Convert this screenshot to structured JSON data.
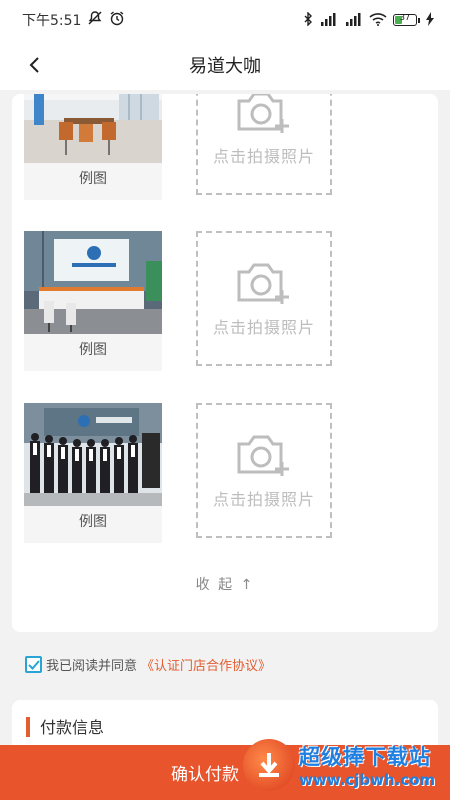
{
  "status": {
    "time": "下午5:51",
    "battery": "37",
    "battery_level": 0.37
  },
  "nav": {
    "title": "易道大咖"
  },
  "upload_rows": [
    {
      "example_label": "例图",
      "upload_text": "点击拍摄照片"
    },
    {
      "example_label": "例图",
      "upload_text": "点击拍摄照片"
    },
    {
      "example_label": "例图",
      "upload_text": "点击拍摄照片"
    }
  ],
  "collapse_label": "收 起 ↑",
  "agreement": {
    "text": "我已阅读并同意",
    "link": "《认证门店合作协议》",
    "checked": true
  },
  "payment": {
    "title": "付款信息"
  },
  "bottom": {
    "confirm_label": "确认付款"
  },
  "watermark": {
    "main": "超级捧下载站",
    "url": "www.cjbwh.com"
  },
  "colors": {
    "accent": "#e8542b",
    "link": "#e35d30",
    "checkbox": "#2aa4d4"
  }
}
